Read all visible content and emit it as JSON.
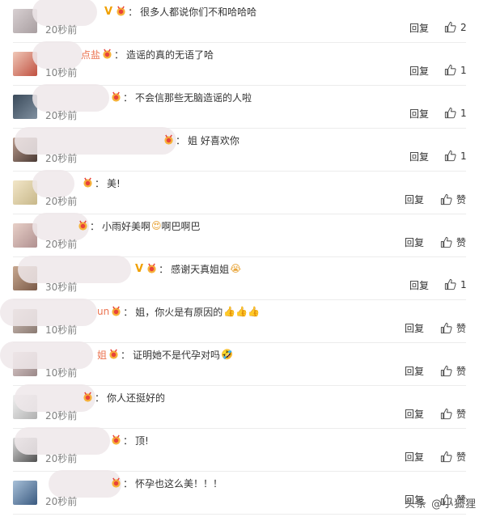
{
  "comments": [
    {
      "name_tail": "",
      "verified": true,
      "text": "很多人都说你们不和哈哈哈",
      "emoji": "",
      "time": "20秒前",
      "reply": "回复",
      "like": "2",
      "liked_style": "count"
    },
    {
      "name_tail": "点盐",
      "verified": false,
      "text": "造谣的真的无语了哈",
      "emoji": "",
      "time": "10秒前",
      "reply": "回复",
      "like": "1",
      "liked_style": "count"
    },
    {
      "name_tail": "",
      "verified": false,
      "text": "不会信那些无脑造谣的人啦",
      "emoji": "",
      "time": "20秒前",
      "reply": "回复",
      "like": "1",
      "liked_style": "count"
    },
    {
      "name_tail": "",
      "verified": false,
      "text": "姐 好喜欢你",
      "emoji": "",
      "time": "20秒前",
      "reply": "回复",
      "like": "1",
      "liked_style": "count"
    },
    {
      "name_tail": "",
      "verified": false,
      "text": "美!",
      "emoji": "",
      "time": "20秒前",
      "reply": "回复",
      "like": "赞",
      "liked_style": "word"
    },
    {
      "name_tail": "",
      "verified": false,
      "text": "小雨好美啊",
      "emoji": "😍",
      "text_after": "啊巴啊巴",
      "time": "20秒前",
      "reply": "回复",
      "like": "赞",
      "liked_style": "word"
    },
    {
      "name_tail": "",
      "verified": true,
      "text": "感谢天真姐姐",
      "emoji": "😭",
      "time": "30秒前",
      "reply": "回复",
      "like": "1",
      "liked_style": "count"
    },
    {
      "name_tail": "un",
      "verified": false,
      "text": "姐，你火是有原因的",
      "emoji": "👍👍👍",
      "time": "10秒前",
      "reply": "回复",
      "like": "赞",
      "liked_style": "word"
    },
    {
      "name_tail": "姐",
      "verified": false,
      "text": "证明她不是代孕对吗",
      "emoji": "🤣",
      "time": "10秒前",
      "reply": "回复",
      "like": "赞",
      "liked_style": "word"
    },
    {
      "name_tail": "",
      "verified": false,
      "text": "你人还挺好的",
      "emoji": "",
      "time": "20秒前",
      "reply": "回复",
      "like": "赞",
      "liked_style": "word"
    },
    {
      "name_tail": "",
      "verified": false,
      "text": "顶!",
      "emoji": "",
      "time": "20秒前",
      "reply": "回复",
      "like": "赞",
      "liked_style": "word"
    },
    {
      "name_tail": "",
      "verified": false,
      "text": "怀孕也这么美！！！",
      "emoji": "",
      "time": "20秒前",
      "reply": "回复",
      "like": "赞",
      "liked_style": "word"
    }
  ],
  "watermark": "头条 @小狐狸",
  "colors": {
    "name": "#eb7350",
    "verified": "#f0a000",
    "time": "#808080",
    "separator": "#ececec"
  }
}
